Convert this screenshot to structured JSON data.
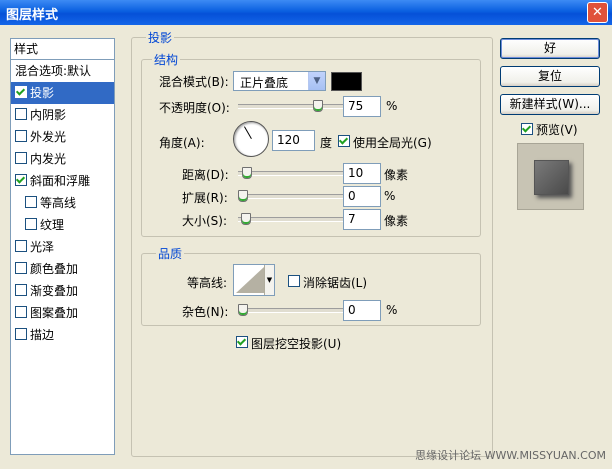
{
  "window": {
    "title": "图层样式",
    "close_glyph": "✕"
  },
  "sidebar": {
    "header": "样式",
    "items": [
      {
        "label": "混合选项:默认",
        "has_checkbox": false,
        "checked": false,
        "selected": false,
        "sub": false
      },
      {
        "label": "投影",
        "has_checkbox": true,
        "checked": true,
        "selected": true,
        "sub": false
      },
      {
        "label": "内阴影",
        "has_checkbox": true,
        "checked": false,
        "selected": false,
        "sub": false
      },
      {
        "label": "外发光",
        "has_checkbox": true,
        "checked": false,
        "selected": false,
        "sub": false
      },
      {
        "label": "内发光",
        "has_checkbox": true,
        "checked": false,
        "selected": false,
        "sub": false
      },
      {
        "label": "斜面和浮雕",
        "has_checkbox": true,
        "checked": true,
        "selected": false,
        "sub": false
      },
      {
        "label": "等高线",
        "has_checkbox": true,
        "checked": false,
        "selected": false,
        "sub": true
      },
      {
        "label": "纹理",
        "has_checkbox": true,
        "checked": false,
        "selected": false,
        "sub": true
      },
      {
        "label": "光泽",
        "has_checkbox": true,
        "checked": false,
        "selected": false,
        "sub": false
      },
      {
        "label": "颜色叠加",
        "has_checkbox": true,
        "checked": false,
        "selected": false,
        "sub": false
      },
      {
        "label": "渐变叠加",
        "has_checkbox": true,
        "checked": false,
        "selected": false,
        "sub": false
      },
      {
        "label": "图案叠加",
        "has_checkbox": true,
        "checked": false,
        "selected": false,
        "sub": false
      },
      {
        "label": "描边",
        "has_checkbox": true,
        "checked": false,
        "selected": false,
        "sub": false
      }
    ]
  },
  "shadow": {
    "title": "投影",
    "structure": {
      "title": "结构",
      "blend_mode_label": "混合模式(B):",
      "blend_mode_value": "正片叠底",
      "blend_color": "#000000",
      "opacity_label": "不透明度(O):",
      "opacity_value": "75",
      "opacity_unit": "%",
      "opacity_fraction": 0.75,
      "angle_label": "角度(A):",
      "angle_value": "120",
      "angle_unit": "度",
      "global_light_label": "使用全局光(G)",
      "global_light_checked": true,
      "distance_label": "距离(D):",
      "distance_value": "10",
      "distance_unit": "像素",
      "distance_fraction": 0.04,
      "spread_label": "扩展(R):",
      "spread_value": "0",
      "spread_unit": "%",
      "spread_fraction": 0.0,
      "size_label": "大小(S):",
      "size_value": "7",
      "size_unit": "像素",
      "size_fraction": 0.03
    },
    "quality": {
      "title": "品质",
      "contour_label": "等高线:",
      "antialias_label": "消除锯齿(L)",
      "antialias_checked": false,
      "noise_label": "杂色(N):",
      "noise_value": "0",
      "noise_unit": "%",
      "noise_fraction": 0.0
    },
    "knockout_label": "图层挖空投影(U)",
    "knockout_checked": true
  },
  "buttons": {
    "ok": "好",
    "reset": "复位",
    "new_style": "新建样式(W)...",
    "preview_label": "预览(V)",
    "preview_checked": true
  },
  "watermark": "思缘设计论坛 WWW.MISSYUAN.COM"
}
